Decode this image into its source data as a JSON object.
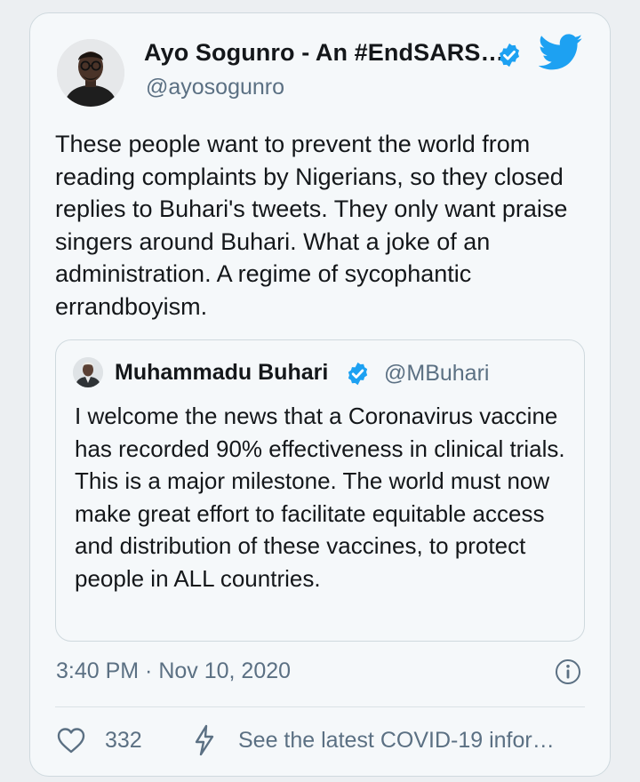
{
  "tweet": {
    "author": {
      "name": "Ayo Sogunro - An #EndSARS…",
      "handle": "@ayosogunro",
      "verified": true
    },
    "text": "These people want to prevent the world from reading complaints by Nigerians, so they closed replies to Buhari's tweets. They only want praise singers around Buhari. What a joke of an administration. A regime of sycophantic errandboyism.",
    "quoted": {
      "name": "Muhammadu Buhari",
      "handle": "@MBuhari",
      "verified": true,
      "text": "I welcome the news that a Coronavirus vaccine has recorded 90% effectiveness in clinical trials. This is a major milestone. The world must now make great effort to facilitate equitable access and distribution of these vaccines, to protect people in ALL countries."
    },
    "timestamp": "3:40 PM · Nov 10, 2020",
    "actions": {
      "like_count": "332",
      "covid_link": "See the latest COVID-19 infor…"
    }
  },
  "icons": {
    "brand": "twitter-bird-icon",
    "verified": "verified-badge-icon",
    "info": "info-icon",
    "like": "heart-icon",
    "covid": "lightning-bolt-icon"
  },
  "colors": {
    "brand": "#1da1f2",
    "text": "#14171a",
    "secondary_text": "#5b7083",
    "card_background": "#f5f8fa",
    "border": "#cfd9de"
  }
}
